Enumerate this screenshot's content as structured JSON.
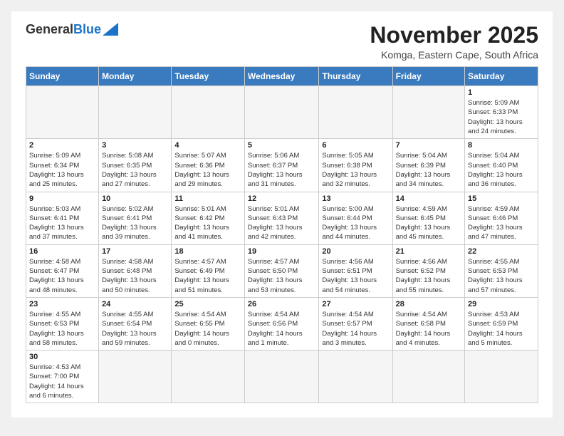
{
  "header": {
    "logo_general": "General",
    "logo_blue": "Blue",
    "month_title": "November 2025",
    "location": "Komga, Eastern Cape, South Africa"
  },
  "days_of_week": [
    "Sunday",
    "Monday",
    "Tuesday",
    "Wednesday",
    "Thursday",
    "Friday",
    "Saturday"
  ],
  "weeks": [
    [
      {
        "num": "",
        "info": ""
      },
      {
        "num": "",
        "info": ""
      },
      {
        "num": "",
        "info": ""
      },
      {
        "num": "",
        "info": ""
      },
      {
        "num": "",
        "info": ""
      },
      {
        "num": "",
        "info": ""
      },
      {
        "num": "1",
        "info": "Sunrise: 5:09 AM\nSunset: 6:33 PM\nDaylight: 13 hours\nand 24 minutes."
      }
    ],
    [
      {
        "num": "2",
        "info": "Sunrise: 5:09 AM\nSunset: 6:34 PM\nDaylight: 13 hours\nand 25 minutes."
      },
      {
        "num": "3",
        "info": "Sunrise: 5:08 AM\nSunset: 6:35 PM\nDaylight: 13 hours\nand 27 minutes."
      },
      {
        "num": "4",
        "info": "Sunrise: 5:07 AM\nSunset: 6:36 PM\nDaylight: 13 hours\nand 29 minutes."
      },
      {
        "num": "5",
        "info": "Sunrise: 5:06 AM\nSunset: 6:37 PM\nDaylight: 13 hours\nand 31 minutes."
      },
      {
        "num": "6",
        "info": "Sunrise: 5:05 AM\nSunset: 6:38 PM\nDaylight: 13 hours\nand 32 minutes."
      },
      {
        "num": "7",
        "info": "Sunrise: 5:04 AM\nSunset: 6:39 PM\nDaylight: 13 hours\nand 34 minutes."
      },
      {
        "num": "8",
        "info": "Sunrise: 5:04 AM\nSunset: 6:40 PM\nDaylight: 13 hours\nand 36 minutes."
      }
    ],
    [
      {
        "num": "9",
        "info": "Sunrise: 5:03 AM\nSunset: 6:41 PM\nDaylight: 13 hours\nand 37 minutes."
      },
      {
        "num": "10",
        "info": "Sunrise: 5:02 AM\nSunset: 6:41 PM\nDaylight: 13 hours\nand 39 minutes."
      },
      {
        "num": "11",
        "info": "Sunrise: 5:01 AM\nSunset: 6:42 PM\nDaylight: 13 hours\nand 41 minutes."
      },
      {
        "num": "12",
        "info": "Sunrise: 5:01 AM\nSunset: 6:43 PM\nDaylight: 13 hours\nand 42 minutes."
      },
      {
        "num": "13",
        "info": "Sunrise: 5:00 AM\nSunset: 6:44 PM\nDaylight: 13 hours\nand 44 minutes."
      },
      {
        "num": "14",
        "info": "Sunrise: 4:59 AM\nSunset: 6:45 PM\nDaylight: 13 hours\nand 45 minutes."
      },
      {
        "num": "15",
        "info": "Sunrise: 4:59 AM\nSunset: 6:46 PM\nDaylight: 13 hours\nand 47 minutes."
      }
    ],
    [
      {
        "num": "16",
        "info": "Sunrise: 4:58 AM\nSunset: 6:47 PM\nDaylight: 13 hours\nand 48 minutes."
      },
      {
        "num": "17",
        "info": "Sunrise: 4:58 AM\nSunset: 6:48 PM\nDaylight: 13 hours\nand 50 minutes."
      },
      {
        "num": "18",
        "info": "Sunrise: 4:57 AM\nSunset: 6:49 PM\nDaylight: 13 hours\nand 51 minutes."
      },
      {
        "num": "19",
        "info": "Sunrise: 4:57 AM\nSunset: 6:50 PM\nDaylight: 13 hours\nand 53 minutes."
      },
      {
        "num": "20",
        "info": "Sunrise: 4:56 AM\nSunset: 6:51 PM\nDaylight: 13 hours\nand 54 minutes."
      },
      {
        "num": "21",
        "info": "Sunrise: 4:56 AM\nSunset: 6:52 PM\nDaylight: 13 hours\nand 55 minutes."
      },
      {
        "num": "22",
        "info": "Sunrise: 4:55 AM\nSunset: 6:53 PM\nDaylight: 13 hours\nand 57 minutes."
      }
    ],
    [
      {
        "num": "23",
        "info": "Sunrise: 4:55 AM\nSunset: 6:53 PM\nDaylight: 13 hours\nand 58 minutes."
      },
      {
        "num": "24",
        "info": "Sunrise: 4:55 AM\nSunset: 6:54 PM\nDaylight: 13 hours\nand 59 minutes."
      },
      {
        "num": "25",
        "info": "Sunrise: 4:54 AM\nSunset: 6:55 PM\nDaylight: 14 hours\nand 0 minutes."
      },
      {
        "num": "26",
        "info": "Sunrise: 4:54 AM\nSunset: 6:56 PM\nDaylight: 14 hours\nand 1 minute."
      },
      {
        "num": "27",
        "info": "Sunrise: 4:54 AM\nSunset: 6:57 PM\nDaylight: 14 hours\nand 3 minutes."
      },
      {
        "num": "28",
        "info": "Sunrise: 4:54 AM\nSunset: 6:58 PM\nDaylight: 14 hours\nand 4 minutes."
      },
      {
        "num": "29",
        "info": "Sunrise: 4:53 AM\nSunset: 6:59 PM\nDaylight: 14 hours\nand 5 minutes."
      }
    ],
    [
      {
        "num": "30",
        "info": "Sunrise: 4:53 AM\nSunset: 7:00 PM\nDaylight: 14 hours\nand 6 minutes."
      },
      {
        "num": "",
        "info": ""
      },
      {
        "num": "",
        "info": ""
      },
      {
        "num": "",
        "info": ""
      },
      {
        "num": "",
        "info": ""
      },
      {
        "num": "",
        "info": ""
      },
      {
        "num": "",
        "info": ""
      }
    ]
  ]
}
